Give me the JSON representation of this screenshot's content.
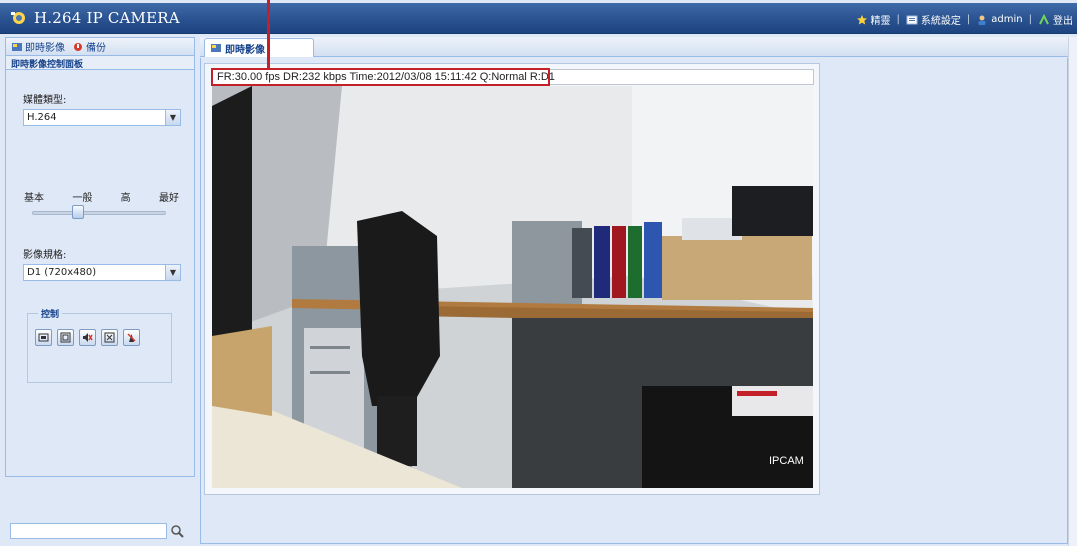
{
  "header": {
    "title": "H.264 IP CAMERA",
    "links": {
      "favorites": "精靈",
      "system_settings": "系統設定",
      "user": "admin",
      "logout": "登出"
    }
  },
  "left_panel": {
    "tabs": [
      "即時影像",
      "備份"
    ],
    "panel_title": "即時影像控制面板",
    "codec": {
      "label": "媒體類型:",
      "value": "H.264"
    },
    "quality": {
      "labels": [
        "基本",
        "一般",
        "高",
        "最好"
      ],
      "level": 0.33
    },
    "resolution": {
      "label": "影像規格:",
      "value": "D1 (720x480)"
    },
    "control": {
      "legend": "控制"
    }
  },
  "main": {
    "tab_label": "即時影像",
    "info_bar": "FR:30.00 fps  DR:232 kbps Time:2012/03/08 15:11:42 Q:Normal R:D1",
    "video_label": "IPCAM"
  },
  "colors": {
    "header": "#2a5290",
    "panel_bg": "#dfe8f6",
    "border": "#99bbe8",
    "highlight": "#c4202a"
  }
}
